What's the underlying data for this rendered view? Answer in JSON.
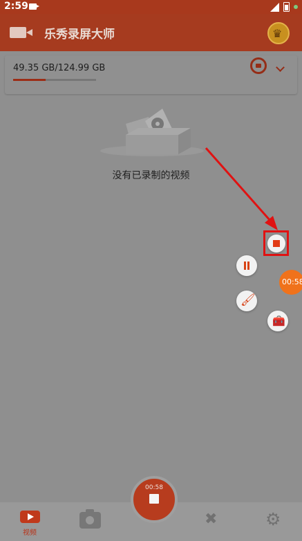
{
  "status_bar": {
    "time": "2:59"
  },
  "app_bar": {
    "title": "乐秀录屏大师"
  },
  "storage": {
    "text": "49.35 GB/124.99 GB",
    "used_fraction": 0.395
  },
  "empty_state": {
    "message": "没有已录制的视频"
  },
  "floating_controls": {
    "timer": "00:58"
  },
  "bottom_nav": {
    "items": [
      {
        "label": "视频",
        "icon": "video-icon",
        "active": true
      },
      {
        "label": "",
        "icon": "camera-icon"
      },
      {
        "label": "",
        "icon": "tools-icon"
      },
      {
        "label": "",
        "icon": "gear-icon"
      }
    ],
    "record_button": {
      "timer": "00:58"
    }
  },
  "colors": {
    "accent": "#a63b1f",
    "highlight_frame": "#e01212",
    "timer_bubble": "#f0721b",
    "dim_background": "#8f8f8f"
  }
}
